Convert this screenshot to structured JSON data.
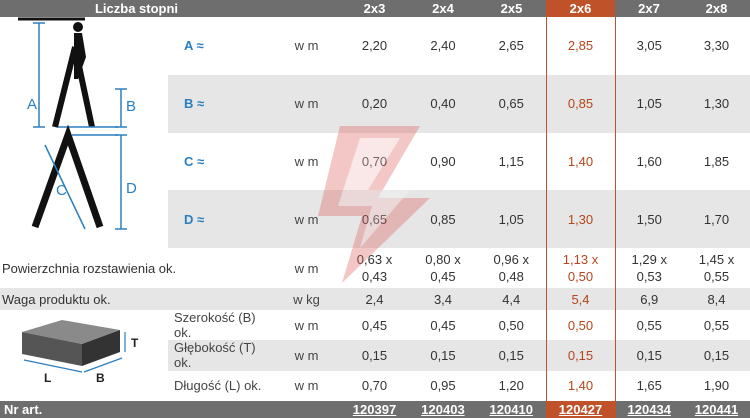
{
  "header": {
    "title": "Liczba stopni",
    "columns": [
      "2x3",
      "2x4",
      "2x5",
      "2x6",
      "2x7",
      "2x8"
    ]
  },
  "dims": [
    {
      "label": "A ≈",
      "unit": "w m",
      "values": [
        "2,20",
        "2,40",
        "2,65",
        "2,85",
        "3,05",
        "3,30"
      ]
    },
    {
      "label": "B ≈",
      "unit": "w m",
      "values": [
        "0,20",
        "0,40",
        "0,65",
        "0,85",
        "1,05",
        "1,30"
      ]
    },
    {
      "label": "C ≈",
      "unit": "w m",
      "values": [
        "0,70",
        "0,90",
        "1,15",
        "1,40",
        "1,60",
        "1,85"
      ]
    },
    {
      "label": "D ≈",
      "unit": "w m",
      "values": [
        "0,65",
        "0,85",
        "1,05",
        "1,30",
        "1,50",
        "1,70"
      ]
    }
  ],
  "surface": {
    "label": "Powierzchnia rozstawienia ok.",
    "unit": "w m",
    "top": [
      "0,63 x",
      "0,80 x",
      "0,96 x",
      "1,13 x",
      "1,29 x",
      "1,45 x"
    ],
    "bottom": [
      "0,43",
      "0,45",
      "0,48",
      "0,50",
      "0,53",
      "0,55"
    ]
  },
  "weight": {
    "label": "Waga produktu ok.",
    "unit": "w kg",
    "values": [
      "2,4",
      "3,4",
      "4,4",
      "5,4",
      "6,9",
      "8,4"
    ]
  },
  "package": [
    {
      "label": "Szerokość (B) ok.",
      "unit": "w m",
      "values": [
        "0,45",
        "0,45",
        "0,50",
        "0,50",
        "0,55",
        "0,55"
      ]
    },
    {
      "label": "Głębokość (T) ok.",
      "unit": "w m",
      "values": [
        "0,15",
        "0,15",
        "0,15",
        "0,15",
        "0,15",
        "0,15"
      ]
    },
    {
      "label": "Długość (L) ok.",
      "unit": "w m",
      "values": [
        "0,70",
        "0,95",
        "1,20",
        "1,40",
        "1,65",
        "1,90"
      ]
    }
  ],
  "footer": {
    "label": "Nr art.",
    "articles": [
      "120397",
      "120403",
      "120410",
      "120427",
      "120434",
      "120441"
    ]
  },
  "figure_letters": {
    "a": "A",
    "b": "B",
    "c": "C",
    "d": "D",
    "t": "T",
    "l": "L",
    "bb": "B"
  },
  "colors": {
    "accent": "#c0522a",
    "header": "#6e6e6e",
    "dim_label": "#2a7fc1",
    "row_alt": "#e6e6e6"
  }
}
